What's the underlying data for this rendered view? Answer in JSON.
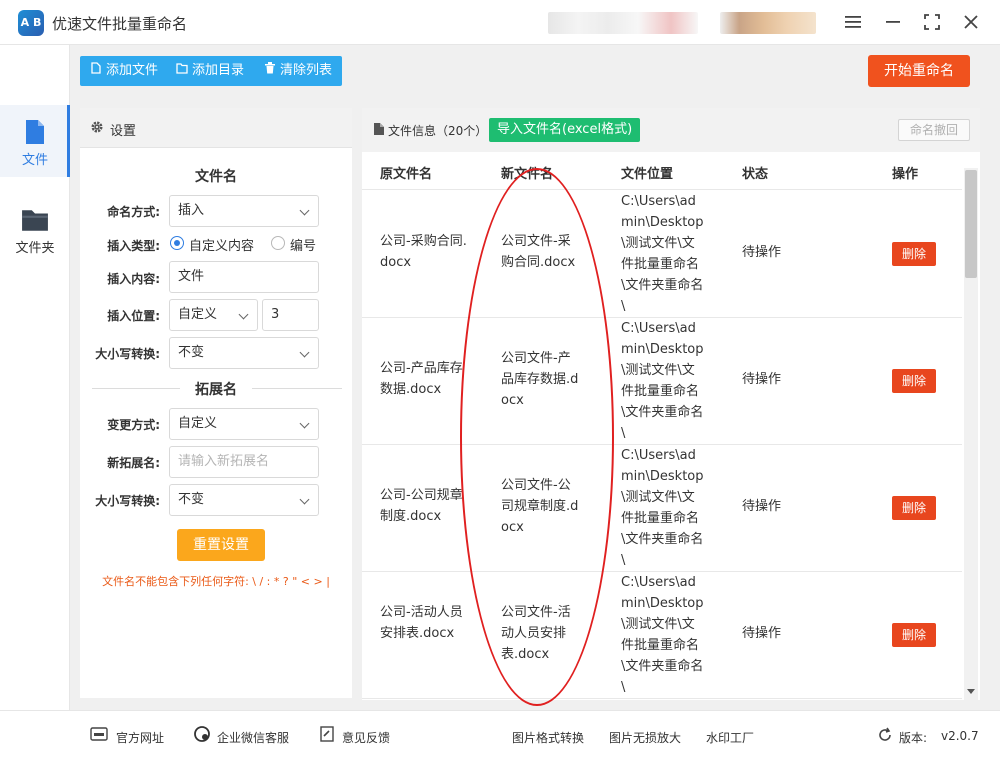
{
  "app": {
    "title": "优速文件批量重命名",
    "logo_text": "A B"
  },
  "window": {
    "menu_icon": "hamburger-icon",
    "minimize_icon": "minimize-icon",
    "maximize_icon": "maximize-icon",
    "close_icon": "close-icon"
  },
  "nav": {
    "items": [
      {
        "label": "文件",
        "icon": "file-icon",
        "active": true
      },
      {
        "label": "文件夹",
        "icon": "folder-icon",
        "active": false
      }
    ]
  },
  "toolbar": {
    "add_file": "添加文件",
    "add_dir": "添加目录",
    "clear_list": "清除列表",
    "start": "开始重命名"
  },
  "settings": {
    "header": "设置",
    "filename_section": "文件名",
    "naming_mode_label": "命名方式:",
    "naming_mode_value": "插入",
    "insert_type_label": "插入类型:",
    "insert_type_opt1": "自定义内容",
    "insert_type_opt2": "编号",
    "insert_content_label": "插入内容:",
    "insert_content_value": "文件",
    "insert_pos_label": "插入位置:",
    "insert_pos_value": "自定义",
    "insert_pos_num": "3",
    "case_label": "大小写转换:",
    "case_value": "不变",
    "ext_section": "拓展名",
    "change_mode_label": "变更方式:",
    "change_mode_value": "自定义",
    "new_ext_label": "新拓展名:",
    "new_ext_placeholder": "请输入新拓展名",
    "ext_case_label": "大小写转换:",
    "ext_case_value": "不变",
    "reset": "重置设置",
    "warning": "文件名不能包含下列任何字符: \\ / : * ? \" < > |"
  },
  "files": {
    "title": "文件信息（20个）",
    "import_btn": "导入文件名(excel格式)",
    "undo_btn": "命名撤回",
    "columns": [
      "原文件名",
      "新文件名",
      "文件位置",
      "状态",
      "操作"
    ],
    "rows": [
      {
        "orig": "公司-采购合同.docx",
        "new": "公司文件-采购合同.docx",
        "loc": "C:\\Users\\admin\\Desktop\\测试文件\\文件批量重命名\\文件夹重命名\\",
        "status": "待操作",
        "action": "删除"
      },
      {
        "orig": "公司-产品库存数据.docx",
        "new": "公司文件-产品库存数据.docx",
        "loc": "C:\\Users\\admin\\Desktop\\测试文件\\文件批量重命名\\文件夹重命名\\",
        "status": "待操作",
        "action": "删除"
      },
      {
        "orig": "公司-公司规章制度.docx",
        "new": "公司文件-公司规章制度.docx",
        "loc": "C:\\Users\\admin\\Desktop\\测试文件\\文件批量重命名\\文件夹重命名\\",
        "status": "待操作",
        "action": "删除"
      },
      {
        "orig": "公司-活动人员安排表.docx",
        "new": "公司文件-活动人员安排表.docx",
        "loc": "C:\\Users\\admin\\Desktop\\测试文件\\文件批量重命名\\文件夹重命名\\",
        "status": "待操作",
        "action": "删除"
      }
    ]
  },
  "footer": {
    "website": "官方网址",
    "wechat": "企业微信客服",
    "feedback": "意见反馈",
    "img_convert": "图片格式转换",
    "img_enlarge": "图片无损放大",
    "watermark": "水印工厂",
    "version_label": "版本:",
    "version": "v2.0.7"
  },
  "colors": {
    "accent": "#2f7de1",
    "toolbar": "#2fa9ee",
    "start": "#f0521e",
    "import": "#1ebd71",
    "delete": "#e8461e",
    "reset": "#fba71c",
    "highlight": "#e02020"
  }
}
